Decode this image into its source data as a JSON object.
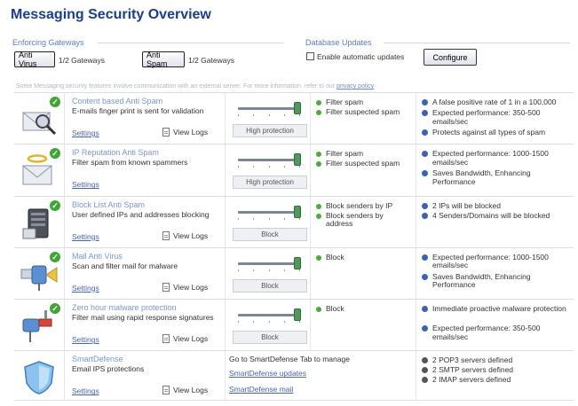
{
  "page_title": "Messaging Security Overview",
  "gateways": {
    "legend": "Enforcing Gateways",
    "anti_virus_button": "Anti Virus",
    "anti_virus_count": "1/2 Gateways",
    "anti_spam_button": "Anti Spam",
    "anti_spam_count": "1/2 Gateways"
  },
  "db_updates": {
    "legend": "Database Updates",
    "auto_updates_label": "Enable automatic updates",
    "configure_button": "Configure"
  },
  "notice": {
    "text": "Some Messaging security features involve communication with an external server. For more information, refer to our",
    "link": "privacy policy"
  },
  "common": {
    "settings": "Settings",
    "view_logs": "View Logs"
  },
  "features": [
    {
      "title": "Content based Anti Spam",
      "desc": "E-mails finger print is sent for validation",
      "slider_label": "High protection",
      "slider_level": 0.95,
      "options": [
        "Filter spam",
        "Filter suspected spam"
      ],
      "info": [
        "A false positive rate of 1 in a 100,000",
        "Expected performance: 350-500 emails/sec",
        "Protects against all types of spam"
      ]
    },
    {
      "title": "IP Reputation Anti Spam",
      "desc": "Filter spam from known spammers",
      "slider_label": "High protection",
      "slider_level": 0.95,
      "options": [
        "Filter spam",
        "Filter suspected spam"
      ],
      "info": [
        "Expected performance: 1000-1500 emails/sec",
        "Saves Bandwidth, Enhancing Performance"
      ]
    },
    {
      "title": "Block List Anti Spam",
      "desc": "User defined IPs and addresses blocking",
      "slider_label": "Block",
      "slider_level": 0.95,
      "options": [
        "Block senders by IP",
        "Block senders by address"
      ],
      "info": [
        "2 IPs will be blocked",
        "4 Senders/Domains will be blocked"
      ]
    },
    {
      "title": "Mail Anti Virus",
      "desc": "Scan and filter mail for malware",
      "slider_label": "Block",
      "slider_level": 0.95,
      "options": [
        "Block"
      ],
      "info": [
        "Expected performance: 1000-1500 emails/sec",
        "Saves Bandwidth, Enhancing Performance"
      ]
    },
    {
      "title": "Zero hour malware protection",
      "desc": "Filter mail using rapid response signatures",
      "slider_label": "Block",
      "slider_level": 0.95,
      "options": [
        "Block"
      ],
      "info": [
        "Immediate proactive malware protection",
        "Expected performance: 350-500 emails/sec"
      ]
    }
  ],
  "smartdefense": {
    "title": "SmartDefense",
    "desc": "Email IPS protections",
    "goto_text": "Go to SmartDefense Tab to manage",
    "link_updates": "SmartDefense updates",
    "link_mail": "SmartDefense mail",
    "info": [
      "2 POP3 servers defined",
      "2 SMTP servers defined",
      "2 IMAP servers defined"
    ]
  },
  "colors": {
    "title": "#1a3d8f",
    "link": "#7a96d0",
    "ok_green": "#3fa535",
    "info_blue": "#3d62b3"
  }
}
